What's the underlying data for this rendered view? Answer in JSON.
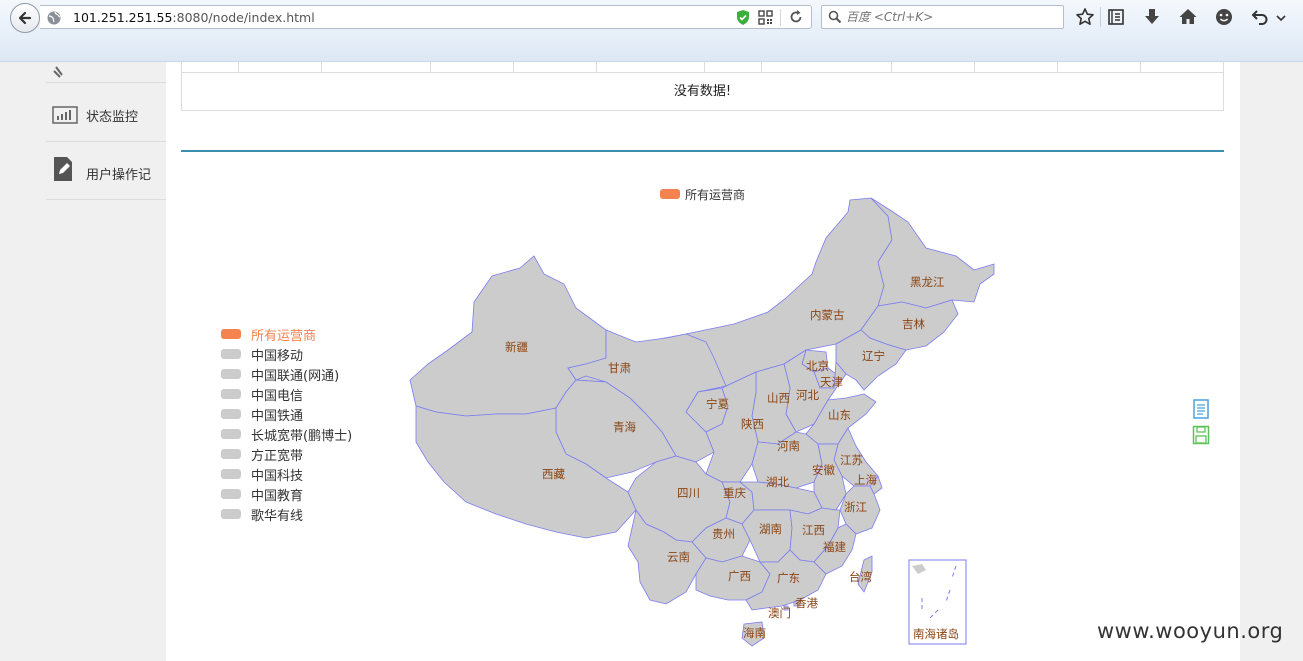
{
  "browser": {
    "url_host": "101.251.251.55",
    "url_rest": ":8080/node/index.html",
    "search_placeholder": "百度 <Ctrl+K>"
  },
  "sidebar": {
    "items": [
      {
        "label": "状态监控",
        "icon": "bar-chart-icon"
      },
      {
        "label": "用户操作记",
        "icon": "edit-document-icon"
      }
    ]
  },
  "table": {
    "empty_text": "没有数据!"
  },
  "map": {
    "legend_top": "所有运营商",
    "legend_items": [
      {
        "label": "所有运营商",
        "selected": true
      },
      {
        "label": "中国移动",
        "selected": false
      },
      {
        "label": "中国联通(网通)",
        "selected": false
      },
      {
        "label": "中国电信",
        "selected": false
      },
      {
        "label": "中国铁通",
        "selected": false
      },
      {
        "label": "长城宽带(鹏博士)",
        "selected": false
      },
      {
        "label": "方正宽带",
        "selected": false
      },
      {
        "label": "中国科技",
        "selected": false
      },
      {
        "label": "中国教育",
        "selected": false
      },
      {
        "label": "歌华有线",
        "selected": false
      }
    ],
    "colors": {
      "selected": "#f5834f",
      "unselected": "#cccccc",
      "province_fill": "#cccccc",
      "border": "#7a7cf0",
      "label": "#8b4513"
    },
    "provinces": {
      "heilongjiang": "黑龙江",
      "jilin": "吉林",
      "liaoning": "辽宁",
      "neimenggu": "内蒙古",
      "beijing": "北京",
      "tianjin": "天津",
      "hebei": "河北",
      "shanxi": "山西",
      "shandong": "山东",
      "xinjiang": "新疆",
      "gansu": "甘肃",
      "ningxia": "宁夏",
      "qinghai": "青海",
      "shaanxi": "陕西",
      "henan": "河南",
      "jiangsu": "江苏",
      "anhui": "安徽",
      "shanghai": "上海",
      "xizang": "西藏",
      "sichuan": "四川",
      "chongqing": "重庆",
      "hubei": "湖北",
      "zhejiang": "浙江",
      "guizhou": "贵州",
      "hunan": "湖南",
      "jiangxi": "江西",
      "fujian": "福建",
      "yunnan": "云南",
      "guangxi": "广西",
      "guangdong": "广东",
      "taiwan": "台湾",
      "hongkong": "香港",
      "macau": "澳门",
      "hainan": "海南",
      "nanhai": "南海诸岛"
    }
  },
  "watermark": "www.wooyun.org"
}
